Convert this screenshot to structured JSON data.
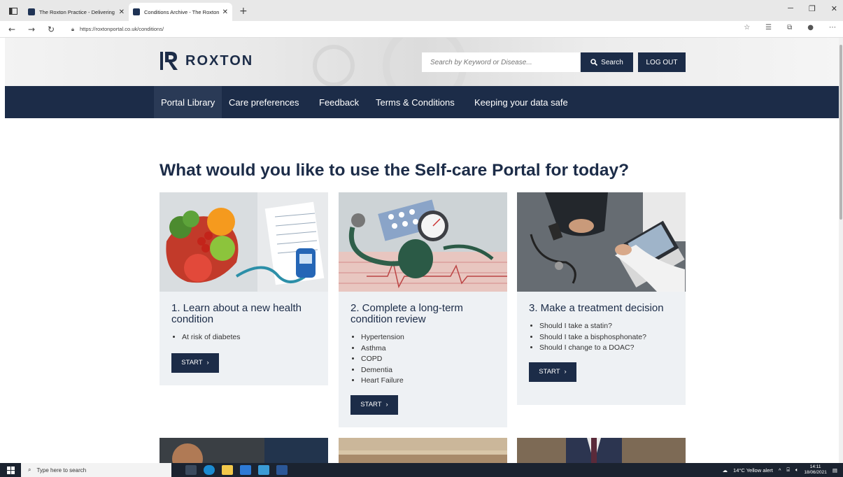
{
  "browser": {
    "tabs": [
      {
        "title": "The Roxton Practice - Delivering",
        "active": false
      },
      {
        "title": "Conditions Archive - The Roxton",
        "active": true
      }
    ],
    "url": "https://roxtonportal.co.uk/conditions/",
    "colors": {
      "tabbar": "#e8e8e8",
      "active_tab": "#ffffff"
    }
  },
  "header": {
    "logo_text": "ROXTON",
    "search_placeholder": "Search by Keyword or Disease...",
    "search_button": "Search",
    "logout_button": "LOG OUT"
  },
  "nav": {
    "items": [
      {
        "label": "Portal Library",
        "active": true
      },
      {
        "label": "Care preferences"
      },
      {
        "label": "Feedback"
      },
      {
        "label": "Terms & Conditions"
      },
      {
        "label": "Keeping your data safe"
      }
    ]
  },
  "main": {
    "headline": "What would you like to use the Self-care Portal for today?",
    "cards": [
      {
        "title": "1. Learn about a new health condition",
        "items": [
          "At risk of diabetes"
        ],
        "button": "START"
      },
      {
        "title": "2. Complete a long-term condition review",
        "items": [
          "Hypertension",
          "Asthma",
          "COPD",
          "Dementia",
          "Heart Failure"
        ],
        "button": "START"
      },
      {
        "title": "3. Make a treatment decision",
        "items": [
          "Should I take a statin?",
          "Should I take a bisphosphonate?",
          "Should I change to a DOAC?"
        ],
        "button": "START"
      }
    ]
  },
  "taskbar": {
    "search_placeholder": "Type here to search",
    "weather": "14°C  Yellow alert",
    "time": "14:11",
    "date": "18/06/2021"
  },
  "theme": {
    "brand_navy": "#1c2c48",
    "card_bg": "#eef1f4"
  }
}
